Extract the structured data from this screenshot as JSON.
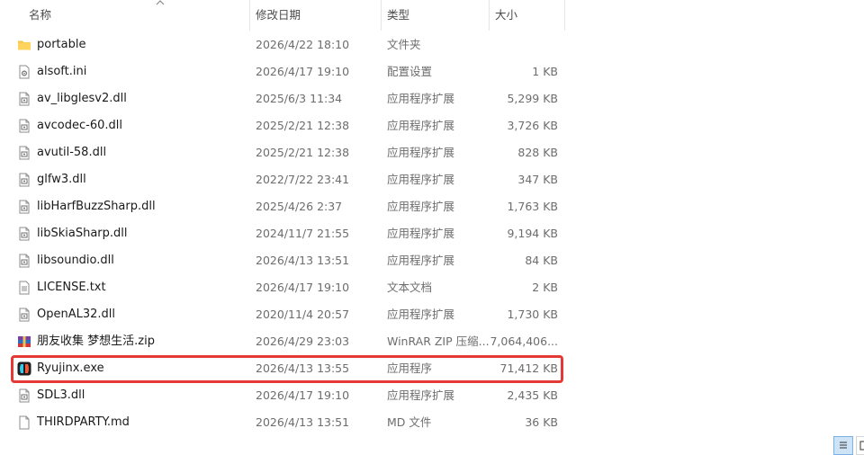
{
  "columns": {
    "name": "名称",
    "date": "修改日期",
    "type": "类型",
    "size": "大小"
  },
  "files": [
    {
      "name": "portable",
      "date": "2026/4/22 18:10",
      "type": "文件夹",
      "size": "",
      "icon": "folder-icon"
    },
    {
      "name": "alsoft.ini",
      "date": "2026/4/17 19:10",
      "type": "配置设置",
      "size": "1 KB",
      "icon": "config-file-icon"
    },
    {
      "name": "av_libglesv2.dll",
      "date": "2025/6/3 11:34",
      "type": "应用程序扩展",
      "size": "5,299 KB",
      "icon": "dll-file-icon"
    },
    {
      "name": "avcodec-60.dll",
      "date": "2025/2/21 12:38",
      "type": "应用程序扩展",
      "size": "3,726 KB",
      "icon": "dll-file-icon"
    },
    {
      "name": "avutil-58.dll",
      "date": "2025/2/21 12:38",
      "type": "应用程序扩展",
      "size": "828 KB",
      "icon": "dll-file-icon"
    },
    {
      "name": "glfw3.dll",
      "date": "2022/7/22 23:41",
      "type": "应用程序扩展",
      "size": "347 KB",
      "icon": "dll-file-icon"
    },
    {
      "name": "libHarfBuzzSharp.dll",
      "date": "2025/4/26 2:37",
      "type": "应用程序扩展",
      "size": "1,763 KB",
      "icon": "dll-file-icon"
    },
    {
      "name": "libSkiaSharp.dll",
      "date": "2024/11/7 21:55",
      "type": "应用程序扩展",
      "size": "9,194 KB",
      "icon": "dll-file-icon"
    },
    {
      "name": "libsoundio.dll",
      "date": "2026/4/13 13:51",
      "type": "应用程序扩展",
      "size": "84 KB",
      "icon": "dll-file-icon"
    },
    {
      "name": "LICENSE.txt",
      "date": "2026/4/17 19:10",
      "type": "文本文档",
      "size": "2 KB",
      "icon": "text-file-icon"
    },
    {
      "name": "OpenAL32.dll",
      "date": "2020/11/4 20:57",
      "type": "应用程序扩展",
      "size": "1,730 KB",
      "icon": "dll-file-icon"
    },
    {
      "name": "朋友收集 梦想生活.zip",
      "date": "2026/4/29 23:03",
      "type": "WinRAR ZIP 压缩...",
      "size": "7,064,406...",
      "icon": "winrar-archive-icon"
    },
    {
      "name": "Ryujinx.exe",
      "date": "2026/4/13 13:55",
      "type": "应用程序",
      "size": "71,412 KB",
      "icon": "ryujinx-app-icon"
    },
    {
      "name": "SDL3.dll",
      "date": "2026/4/17 19:10",
      "type": "应用程序扩展",
      "size": "2,435 KB",
      "icon": "dll-file-icon"
    },
    {
      "name": "THIRDPARTY.md",
      "date": "2026/4/13 13:51",
      "type": "MD 文件",
      "size": "36 KB",
      "icon": "markdown-file-icon"
    }
  ],
  "highlight": {
    "target": "Ryujinx.exe",
    "color": "#e53935"
  },
  "colors": {
    "folder": "#f5c542",
    "details_view_active": "#cfe3f7"
  }
}
